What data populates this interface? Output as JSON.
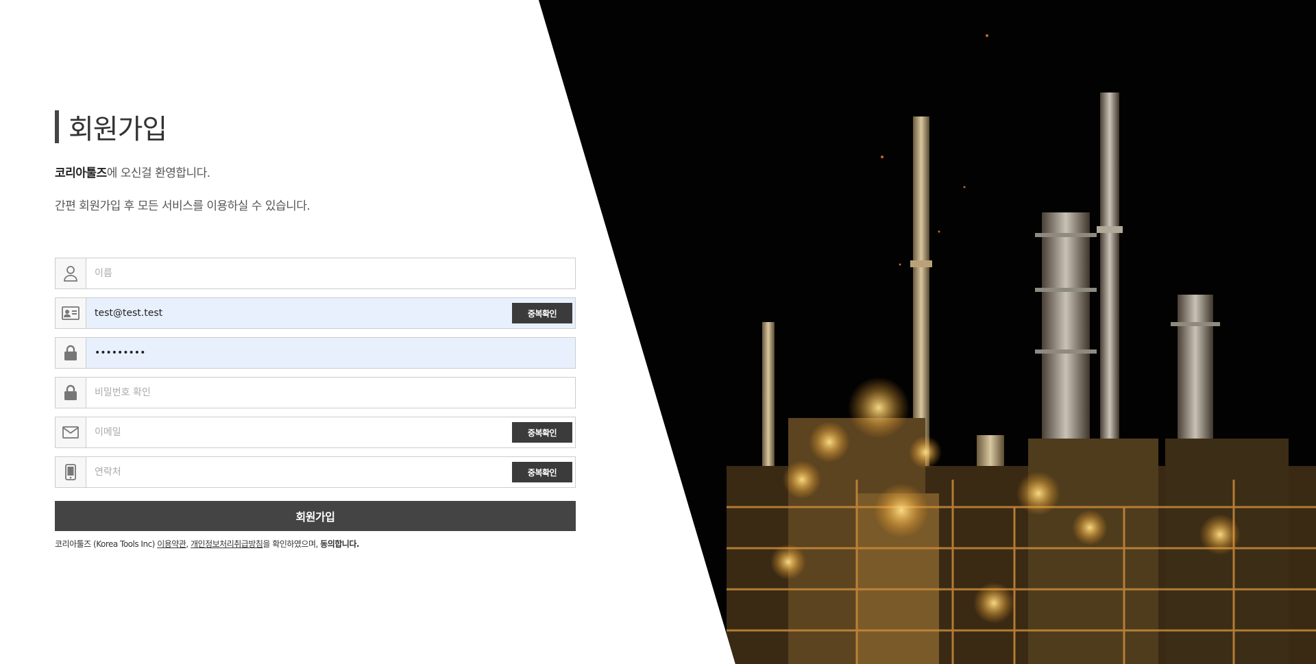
{
  "page": {
    "title": "회원가입",
    "intro_brand": "코리아툴즈",
    "intro_line1_rest": "에 오신걸 환영합니다.",
    "intro_line2": "간편 회원가입 후 모든 서비스를 이용하실 수 있습니다."
  },
  "fields": {
    "name": {
      "placeholder": "이름",
      "value": "",
      "icon": "user-icon"
    },
    "id": {
      "placeholder": "",
      "value": "test@test.test",
      "icon": "id-card-icon",
      "button": "중복확인"
    },
    "password": {
      "placeholder": "",
      "value": "•••••••••",
      "icon": "lock-icon"
    },
    "password_confirm": {
      "placeholder": "비밀번호 확인",
      "value": "",
      "icon": "lock-icon"
    },
    "email": {
      "placeholder": "이메일",
      "value": "",
      "icon": "mail-icon",
      "button": "중복확인"
    },
    "phone": {
      "placeholder": "연락처",
      "value": "",
      "icon": "phone-icon",
      "button": "중복확인"
    }
  },
  "submit_label": "회원가입",
  "terms": {
    "company": "코리아툴즈",
    "company_en": "(Korea Tools Inc)",
    "link_terms": "이용약관",
    "sep": ",",
    "link_privacy": "개인정보처리취급방침",
    "tail": "을 확인하였으며,",
    "agree": "동의합니다."
  },
  "colors": {
    "dark_button": "#3b3b3b",
    "autofill_bg": "#e8f0fe",
    "border": "#cccccc"
  },
  "hero": {
    "subject": "industrial refinery at night"
  }
}
